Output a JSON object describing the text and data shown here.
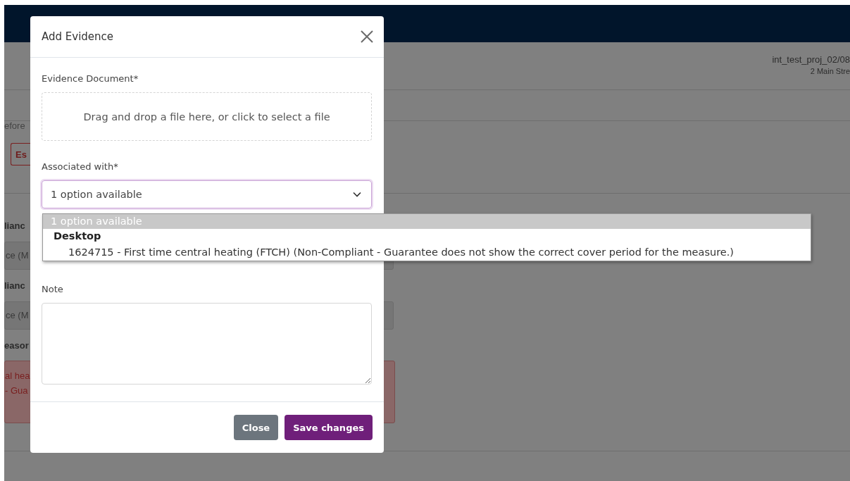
{
  "background": {
    "project_name": "int_test_proj_02/08",
    "project_address": "2 Main Stre",
    "fragments": [
      {
        "kind": "text",
        "text": "efore"
      },
      {
        "kind": "button",
        "text": "Es"
      },
      {
        "kind": "label",
        "text": "lianc"
      },
      {
        "kind": "field",
        "text": "ce (M"
      },
      {
        "kind": "label",
        "text": "lianc"
      },
      {
        "kind": "field",
        "text": "ce (M"
      },
      {
        "kind": "label",
        "text": "easor"
      },
      {
        "kind": "alert",
        "lines": [
          "al hea",
          "- Gua"
        ]
      }
    ]
  },
  "modal": {
    "title": "Add Evidence",
    "document": {
      "label": "Evidence Document*",
      "placeholder": "Drag and drop a file here, or click to select a file"
    },
    "associated": {
      "label": "Associated with*",
      "value": "1 option available",
      "open": true,
      "items": [
        {
          "kind": "prompt",
          "text": "1 option available",
          "selected": true
        },
        {
          "kind": "group",
          "text": "Desktop",
          "selected": false
        },
        {
          "kind": "option",
          "text": "1624715 - First time central heating (FTCH) (Non-Compliant - Guarantee does not show the correct cover period for the measure.)",
          "selected": false
        }
      ]
    },
    "note": {
      "label": "Note"
    },
    "buttons": [
      {
        "kind": "secondary",
        "label": "Close"
      },
      {
        "kind": "primary",
        "label": "Save changes"
      }
    ]
  }
}
